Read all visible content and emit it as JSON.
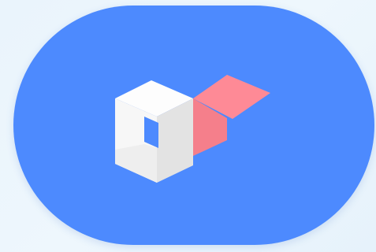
{
  "app_icon": {
    "icon": "cube-with-pink-flag-icon",
    "colors": {
      "background_top": "#eaf4fc",
      "pill": "#4d8afe",
      "cube_front_light": "#f7f7f7",
      "cube_front_shade": "#eeeeee",
      "cube_side_shade": "#e3e3e3",
      "cube_top": "#fdfdfd",
      "window": "#4d8afe",
      "flag": "#fe8a96",
      "flag_side": "#f57f8b"
    }
  }
}
